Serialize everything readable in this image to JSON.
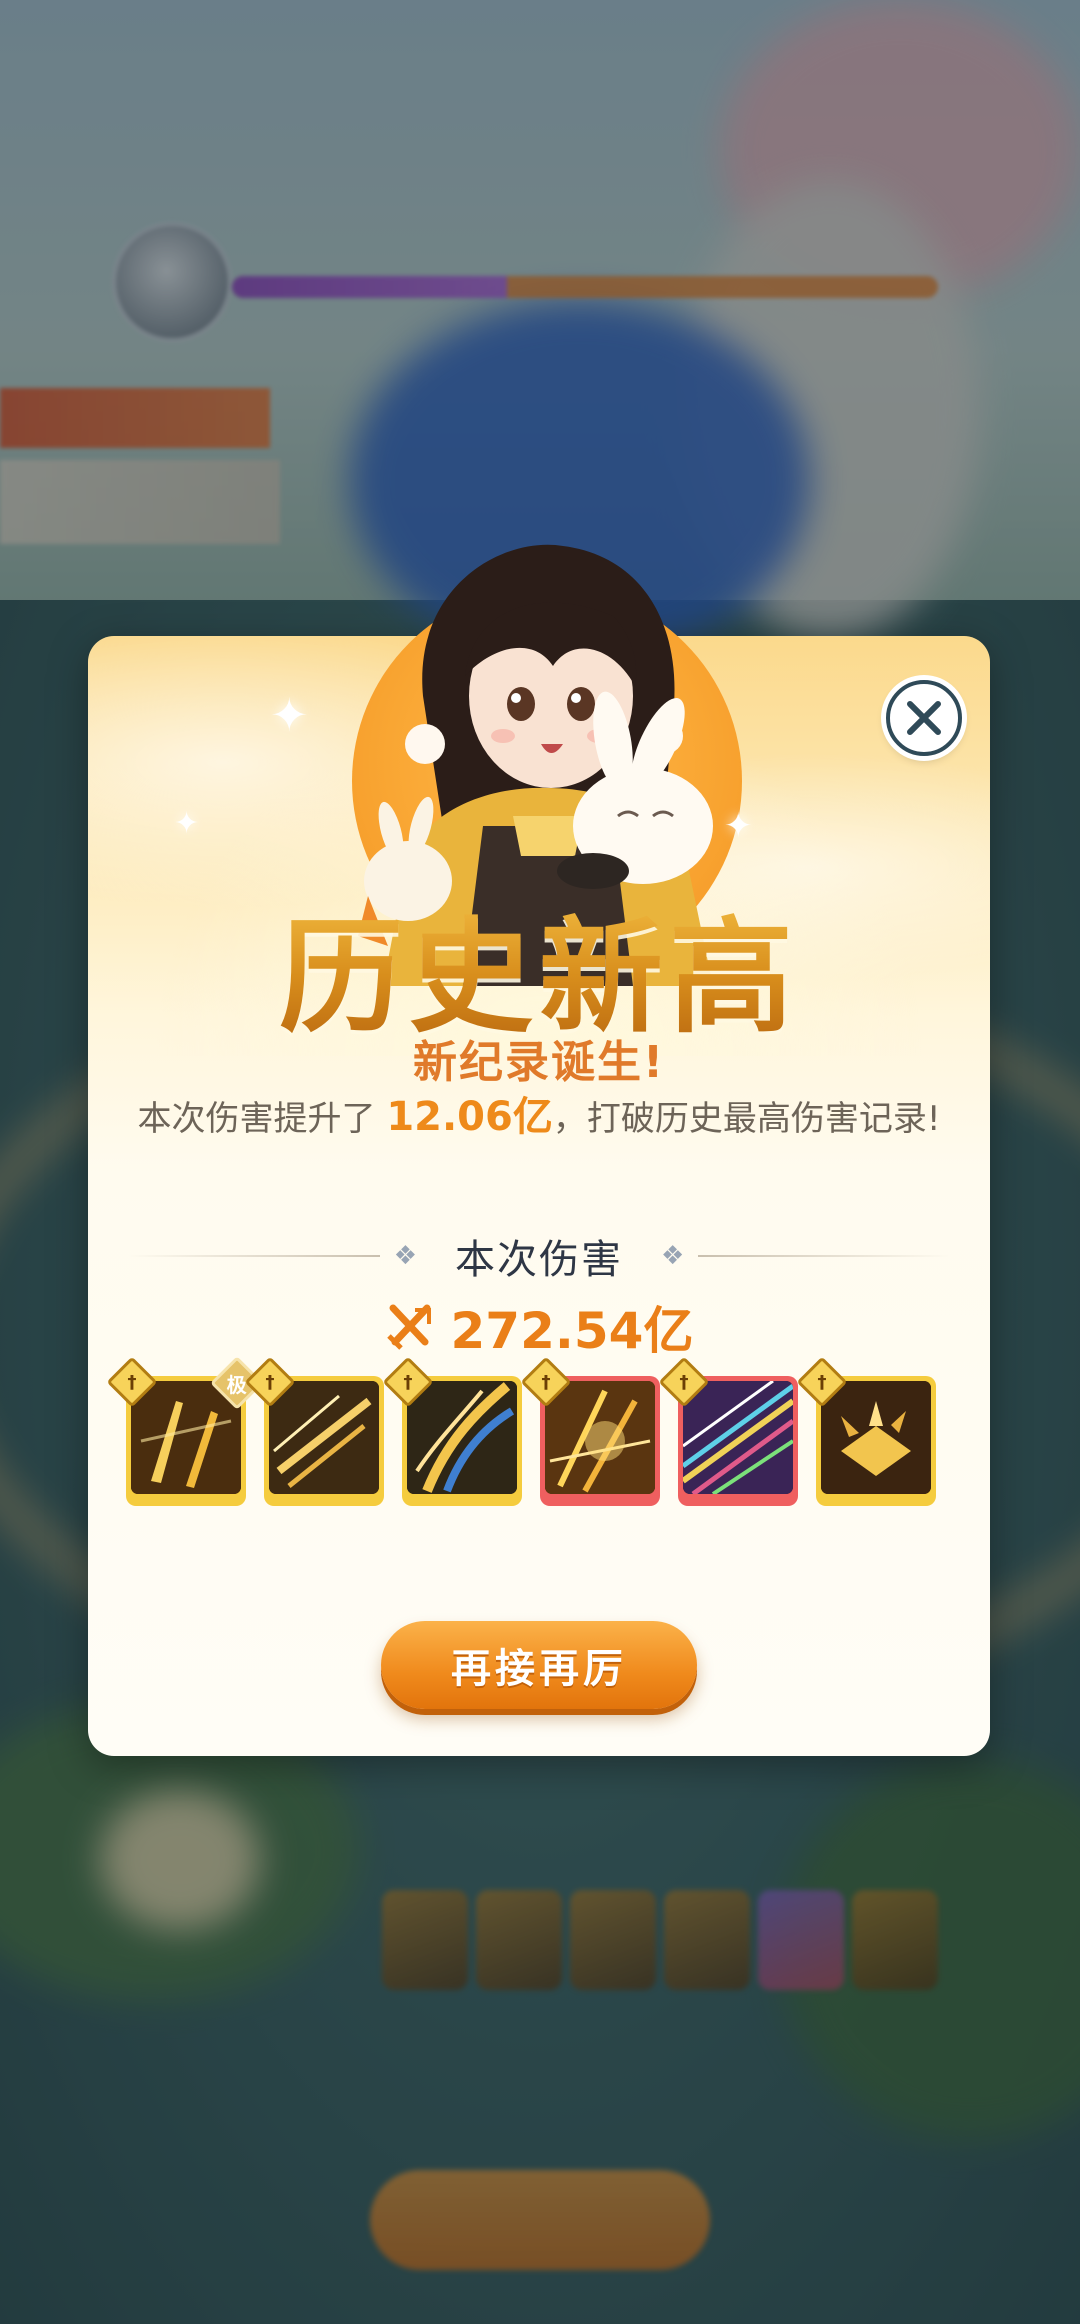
{
  "background": {
    "boss_hp_fraction": 0.39
  },
  "popup": {
    "title": "历史新高",
    "subtitle": "新纪录诞生!",
    "description_prefix": "本次伤害提升了",
    "improvement": "12.06亿",
    "description_suffix": "，打破历史最高伤害记录!",
    "section_title": "本次伤害",
    "damage_value": "272.54亿",
    "skills": [
      {
        "frame": "gold",
        "tag": "极",
        "art": "golden-swords"
      },
      {
        "frame": "gold",
        "tag": "",
        "art": "golden-arrows"
      },
      {
        "frame": "gold",
        "tag": "",
        "art": "blue-claw-slash"
      },
      {
        "frame": "red",
        "tag": "",
        "art": "golden-spears"
      },
      {
        "frame": "red",
        "tag": "",
        "art": "rainbow-beams"
      },
      {
        "frame": "gold",
        "tag": "",
        "art": "golden-shards"
      }
    ],
    "again_button": "再接再厉",
    "close_icon": "close-icon"
  },
  "colors": {
    "accent_orange": "#ea7f18",
    "title_gold": "#d88e1c",
    "frame_gold": "#f5cc3e",
    "frame_red": "#ef5f5f"
  }
}
